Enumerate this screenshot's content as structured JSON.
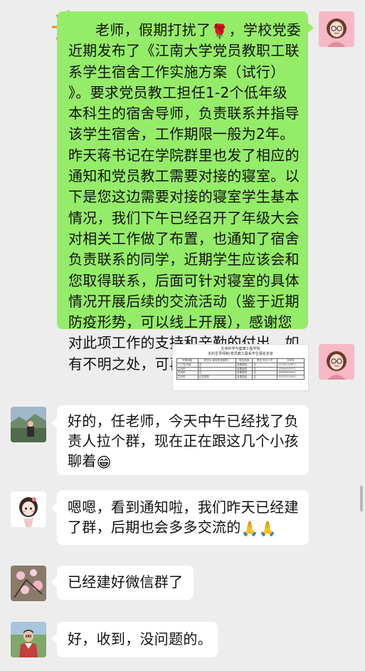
{
  "messages": [
    {
      "sender": "me",
      "lines": [
        "老师，假期打扰了",
        "近期发布了《江南大学党员教职工联",
        "系学生宿舍工作实施方案（试行）",
        "》。要求党员教工担任1-2个低年级",
        "本科生的宿舍导师，负责联系并指导",
        "该学生宿舍，工作期限一般为2年。",
        "昨天蒋书记在学院群里也发了相应的",
        "通知和党员教工需要对接的寝室。以",
        "下是您这边需要对接的寝室学生基本",
        "情况，我们下午已经召开了年级大会",
        "对相关工作做了布置，也通知了宿舍",
        "负责联系的同学，近期学生应该会和",
        "您取得联系，后面可针对寝室的具体",
        "情况开展后续的交流活动（鉴于近期",
        "防疫形势，可以线上开展），感谢您",
        "对此项工作的支持和辛勤的付出，如",
        "有不明之处，可再与我联系"
      ],
      "line1_tail": "，学校党委",
      "emojis": {
        "rose": "🌹",
        "grin": "😁",
        "pray": "🙏",
        "sun": "🌞"
      }
    },
    {
      "sender": "me",
      "type": "document",
      "doc": {
        "title": "生命科学与健康工程学院",
        "subtitle": "本科生导师制/党员教工联系学生报名名单",
        "headers": [
          "学素组组",
          "是否为\n面较性选择群☆",
          "姓名品事",
          "是否\n专业人员",
          "手机号"
        ],
        "rows": [
          [
            "17卫生科组",
            "否",
            "吴素团组",
            "否",
            "15190234901"
          ],
          [
            "生科科",
            "否",
            "吴素团组",
            "否",
            "13989445572"
          ],
          [
            "生科科",
            "否",
            "吴素团组",
            "否",
            "18993908567"
          ],
          [
            "生科科",
            "北院周建",
            "吴素团组",
            "否",
            "15953929490"
          ]
        ]
      }
    },
    {
      "sender": "other",
      "lines": [
        "好的，任老师，今天中午已经找了负",
        "责人拉个群，现在正在跟这几个小孩",
        "聊着"
      ]
    },
    {
      "sender": "other",
      "lines": [
        "嗯嗯，看到通知啦，我们昨天已经建",
        "了群，后期也会多多交流的"
      ]
    },
    {
      "sender": "other",
      "lines": [
        "已经建好微信群了"
      ]
    },
    {
      "sender": "other",
      "lines": [
        "好，收到，没问题的。"
      ]
    }
  ],
  "colors": {
    "background": "#ededed",
    "my_bubble": "#95ec69",
    "other_bubble": "#ffffff"
  }
}
